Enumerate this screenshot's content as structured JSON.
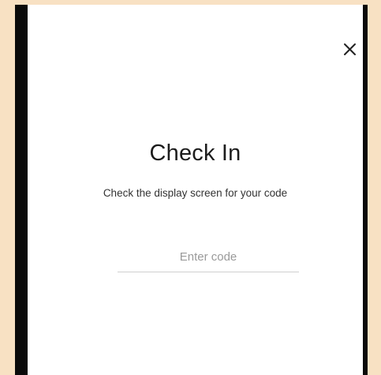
{
  "modal": {
    "title": "Check In",
    "subtitle": "Check the display screen for your code",
    "close_icon": "close-icon"
  },
  "code_input": {
    "placeholder": "Enter code",
    "value": ""
  },
  "colors": {
    "background": "#f8e1c3",
    "frame": "#0a0a0a",
    "screen": "#ffffff",
    "text": "#1c1c1c",
    "placeholder": "#9a9a9a",
    "underline": "#cfcfcf"
  }
}
